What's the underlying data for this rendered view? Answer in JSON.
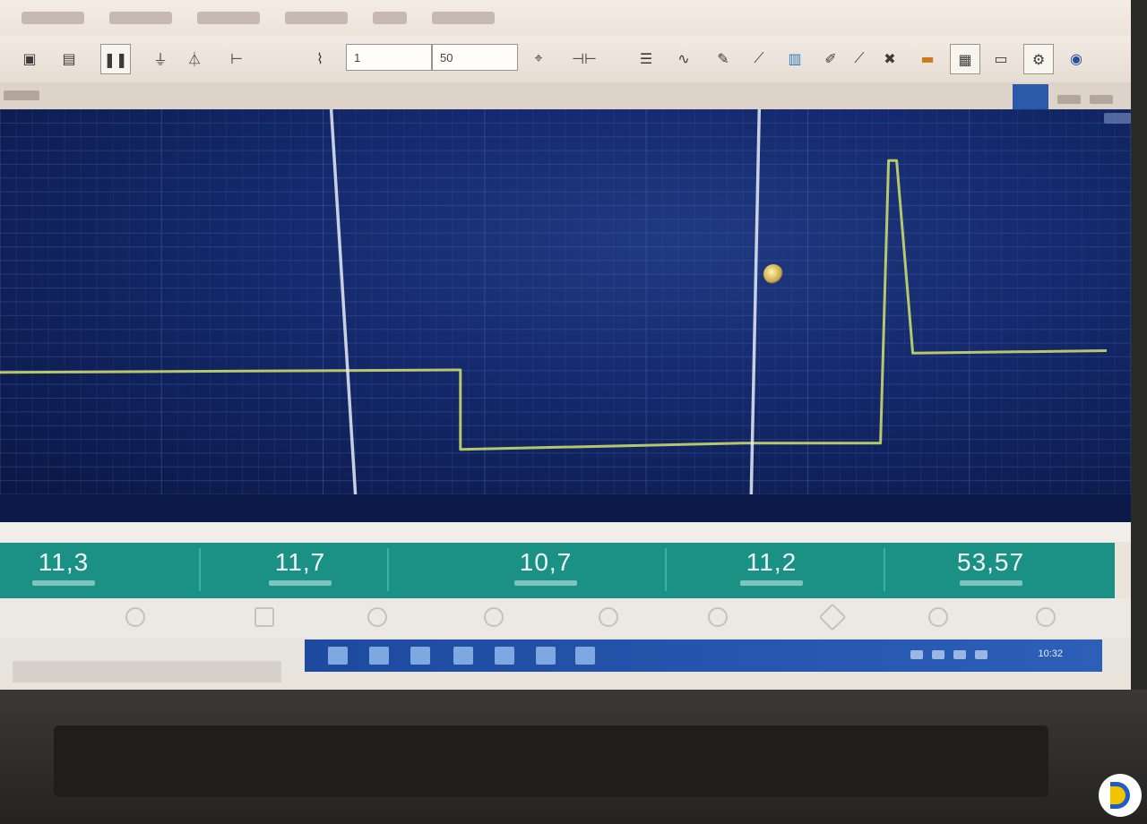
{
  "toolbar": {
    "left_field": "1",
    "right_field": "50"
  },
  "status": {
    "clock": "10:32"
  },
  "readouts": [
    {
      "value": "11,3"
    },
    {
      "value": "11,7"
    },
    {
      "value": "10,7"
    },
    {
      "value": "11,2"
    },
    {
      "value": "53,57"
    }
  ],
  "chart_data": {
    "type": "line",
    "x": [
      0,
      1,
      2,
      3,
      4,
      5,
      6
    ],
    "xlim": [
      0,
      7
    ],
    "ylim": [
      0,
      30
    ],
    "grid": true,
    "legend": "none",
    "series": [
      {
        "color": "#c9d86b",
        "x": [
          0,
          2.85,
          2.85,
          4.6,
          5.45,
          5.5,
          5.55,
          5.65,
          6.85
        ],
        "values": [
          9.5,
          9.7,
          3.5,
          4.0,
          4.0,
          26.0,
          26.0,
          11.0,
          11.2
        ]
      },
      {
        "color": "#e8ecf5",
        "x": [
          2.05,
          2.2
        ],
        "values": [
          30,
          0
        ]
      },
      {
        "color": "#e8ecf5",
        "x": [
          4.7,
          4.65
        ],
        "values": [
          30,
          0
        ]
      }
    ]
  },
  "colors": {
    "plot_bg": "#14286a",
    "readout_bg": "#1a9184",
    "trace": "#c9d86b",
    "cursor_line": "#e8ecf5"
  }
}
